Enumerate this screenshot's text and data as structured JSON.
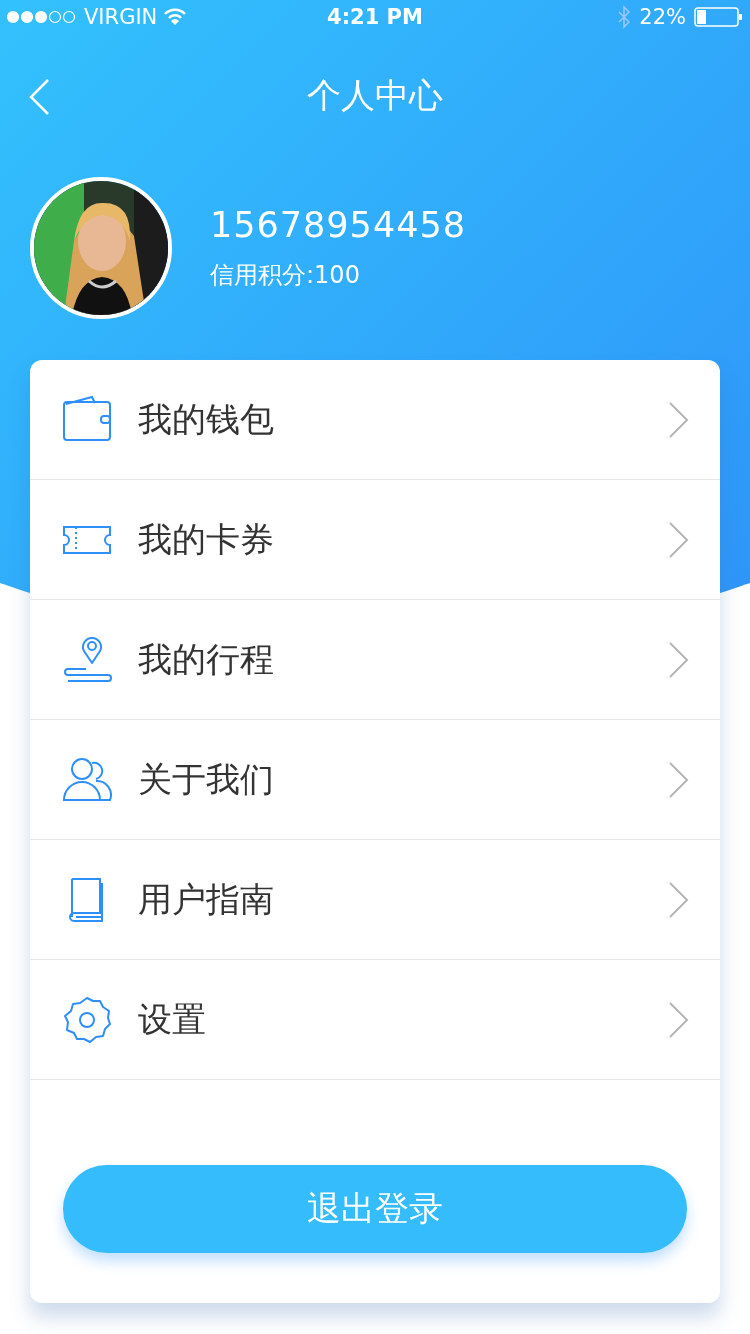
{
  "status_bar": {
    "carrier": "VIRGIN",
    "time": "4:21 PM",
    "battery": "22%"
  },
  "nav": {
    "title": "个人中心"
  },
  "profile": {
    "phone": "15678954458",
    "credit": "信用积分:100"
  },
  "menu": [
    {
      "kind": "wallet",
      "label": "我的钱包"
    },
    {
      "kind": "ticket",
      "label": "我的卡券"
    },
    {
      "kind": "trip",
      "label": "我的行程"
    },
    {
      "kind": "people",
      "label": "关于我们"
    },
    {
      "kind": "book",
      "label": "用户指南"
    },
    {
      "kind": "gear",
      "label": "设置"
    }
  ],
  "logout": "退出登录"
}
